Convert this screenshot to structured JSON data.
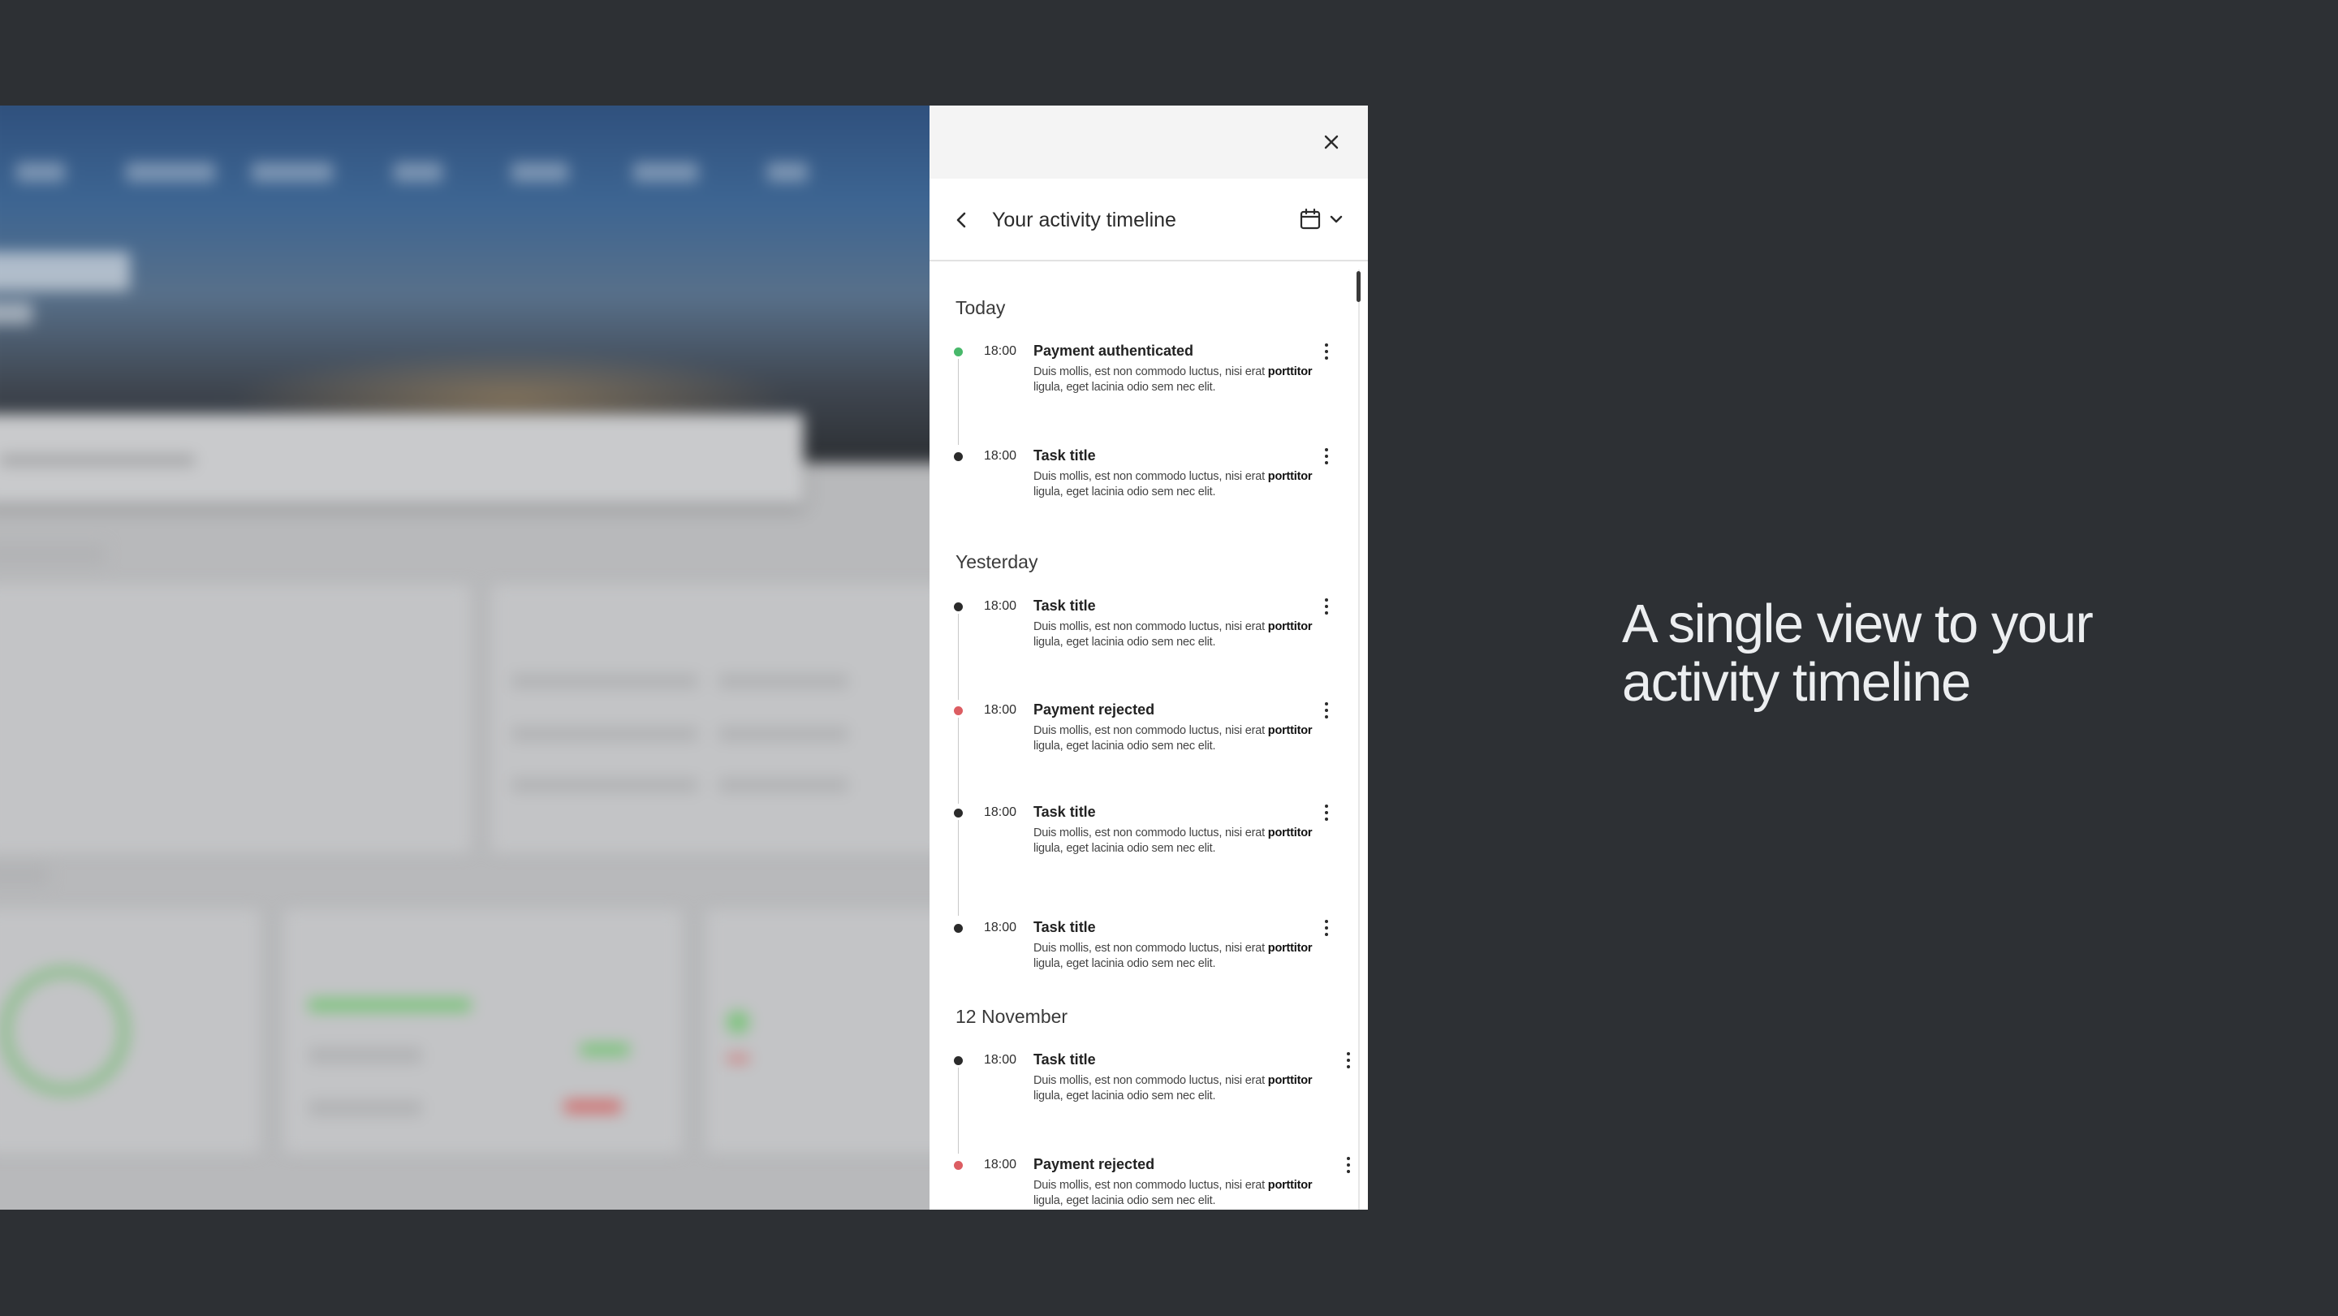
{
  "tagline": "A single view to your activity timeline",
  "panel": {
    "title": "Your activity timeline",
    "close_icon": "close-icon",
    "back_icon": "chevron-left-icon",
    "calendar_icon": "calendar-icon",
    "dropdown_icon": "chevron-down-icon"
  },
  "groups": [
    {
      "label": "Today"
    },
    {
      "label": "Yesterday"
    },
    {
      "label": "12 November"
    }
  ],
  "entries": [
    {
      "time": "18:00",
      "title": "Payment authenticated",
      "status": "green",
      "desc_a": "Duis mollis, est non commodo luctus, nisi erat ",
      "desc_bold": "porttitor",
      "desc_b": " ligula, eget lacinia odio sem nec elit."
    },
    {
      "time": "18:00",
      "title": "Task title",
      "status": "default",
      "desc_a": "Duis mollis, est non commodo luctus, nisi erat ",
      "desc_bold": "porttitor",
      "desc_b": " ligula, eget lacinia odio sem nec elit."
    },
    {
      "time": "18:00",
      "title": "Task title",
      "status": "default",
      "desc_a": "Duis mollis, est non commodo luctus, nisi erat ",
      "desc_bold": "porttitor",
      "desc_b": " ligula, eget lacinia odio sem nec elit."
    },
    {
      "time": "18:00",
      "title": "Payment rejected",
      "status": "red",
      "desc_a": "Duis mollis, est non commodo luctus, nisi erat ",
      "desc_bold": "porttitor",
      "desc_b": " ligula, eget lacinia odio sem nec elit."
    },
    {
      "time": "18:00",
      "title": "Task title",
      "status": "default",
      "desc_a": "Duis mollis, est non commodo luctus, nisi erat ",
      "desc_bold": "porttitor",
      "desc_b": " ligula, eget lacinia odio sem nec elit."
    },
    {
      "time": "18:00",
      "title": "Task title",
      "status": "default",
      "desc_a": "Duis mollis, est non commodo luctus, nisi erat ",
      "desc_bold": "porttitor",
      "desc_b": " ligula, eget lacinia odio sem nec elit."
    },
    {
      "time": "18:00",
      "title": "Task title",
      "status": "default",
      "desc_a": "Duis mollis, est non commodo luctus, nisi erat ",
      "desc_bold": "porttitor",
      "desc_b": " ligula, eget lacinia odio sem nec elit."
    },
    {
      "time": "18:00",
      "title": "Payment rejected",
      "status": "red",
      "desc_a": "Duis mollis, est non commodo luctus, nisi erat ",
      "desc_bold": "porttitor",
      "desc_b": " ligula, eget lacinia odio sem nec elit."
    }
  ],
  "colors": {
    "background": "#2d3034",
    "status_green": "#48b86a",
    "status_red": "#dc5d62",
    "status_default": "#2b2b2b"
  }
}
